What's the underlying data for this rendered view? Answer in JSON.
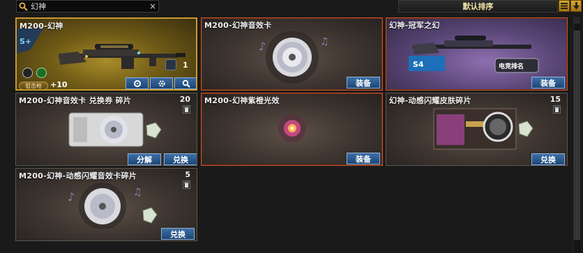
{
  "search": {
    "value": "幻神",
    "clear_label": "×"
  },
  "sort": {
    "label": "默认排序"
  },
  "items": [
    {
      "title": "M200-幻神",
      "count": "1",
      "rank_tag": "狙击枪",
      "plus": "+10"
    },
    {
      "title": "M200-幻神音效卡",
      "button": "装备"
    },
    {
      "title": "幻神-冠军之幻",
      "button": "装备"
    },
    {
      "title": "M200-幻神音效卡 兑换券 碎片",
      "count": "20",
      "button_a": "分解",
      "button_b": "兑换"
    },
    {
      "title": "M200-幻神紫橙光效",
      "button": "装备"
    },
    {
      "title": "幻神-动感闪耀皮肤碎片",
      "count": "15",
      "button": "兑换"
    },
    {
      "title": "M200-幻神-动感闪耀音效卡碎片",
      "count": "5",
      "button": "兑换"
    }
  ],
  "colors": {
    "selected_gold": "#c89a2b",
    "selected_orange": "#c0552a",
    "button_blue": "#2a5a90"
  }
}
